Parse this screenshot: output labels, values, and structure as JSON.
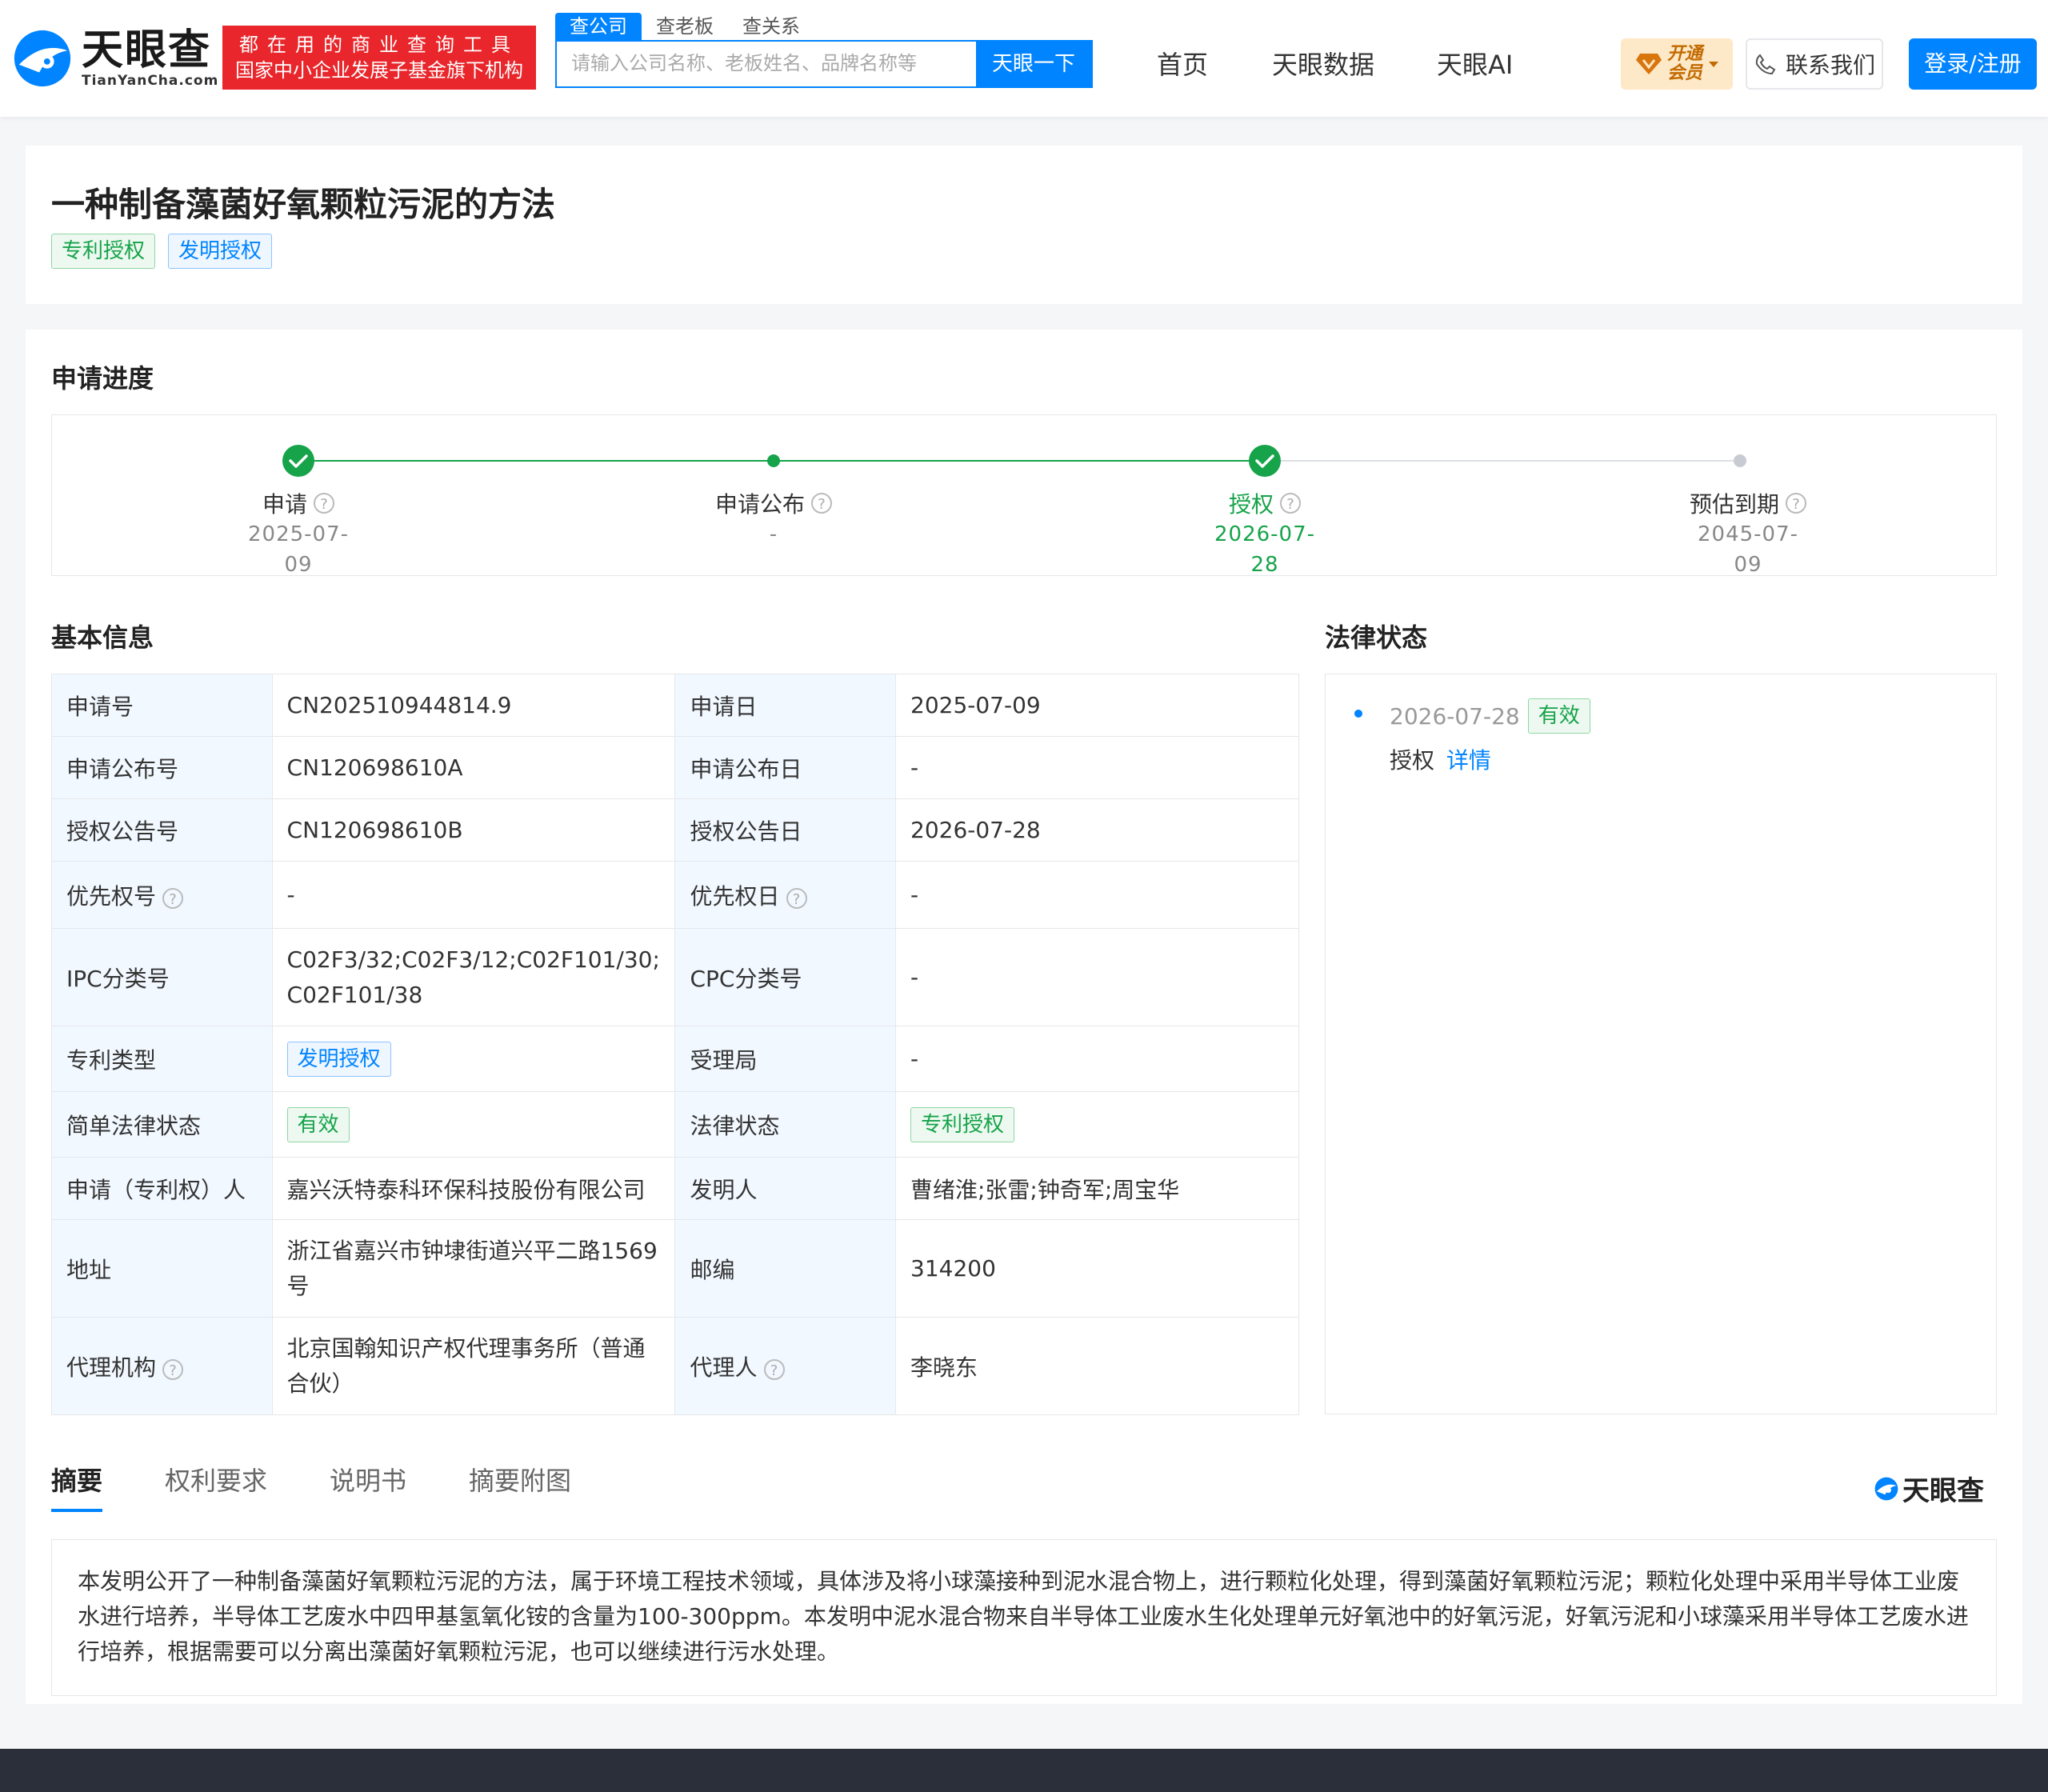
{
  "header": {
    "logo_cn": "天眼查",
    "logo_en": "TianYanCha.com",
    "slogan_line1": "都在用的商业查询工具",
    "slogan_line2": "国家中小企业发展子基金旗下机构",
    "search_tabs": [
      "查公司",
      "查老板",
      "查关系"
    ],
    "search_placeholder": "请输入公司名称、老板姓名、品牌名称等",
    "search_button": "天眼一下",
    "nav": [
      "首页",
      "天眼数据",
      "天眼AI"
    ],
    "vip_line1": "开通",
    "vip_line2": "会员",
    "contact": "联系我们",
    "login": "登录/注册"
  },
  "patent": {
    "title": "一种制备藻菌好氧颗粒污泥的方法",
    "tags": [
      "专利授权",
      "发明授权"
    ]
  },
  "progress": {
    "section_title": "申请进度",
    "steps": [
      {
        "label": "申请",
        "date_line1": "2025-07-",
        "date_line2": "09",
        "state": "done"
      },
      {
        "label": "申请公布",
        "date_line1": "-",
        "date_line2": "",
        "state": "passed"
      },
      {
        "label": "授权",
        "date_line1": "2026-07-",
        "date_line2": "28",
        "state": "current"
      },
      {
        "label": "预估到期",
        "date_line1": "2045-07-",
        "date_line2": "09",
        "state": "future"
      }
    ]
  },
  "basic_info": {
    "section_title": "基本信息",
    "rows": [
      {
        "k1": "申请号",
        "v1": "CN202510944814.9",
        "k2": "申请日",
        "v2": "2025-07-09"
      },
      {
        "k1": "申请公布号",
        "v1": "CN120698610A",
        "k2": "申请公布日",
        "v2": "-"
      },
      {
        "k1": "授权公告号",
        "v1": "CN120698610B",
        "k2": "授权公告日",
        "v2": "2026-07-28"
      },
      {
        "k1": "优先权号",
        "v1": "-",
        "k2": "优先权日",
        "v2": "-"
      },
      {
        "k1": "IPC分类号",
        "v1": "C02F3/32;C02F3/12;C02F101/30;C02F101/38",
        "k2": "CPC分类号",
        "v2": "-"
      },
      {
        "k1": "专利类型",
        "v1": "发明授权",
        "k2": "受理局",
        "v2": "-"
      },
      {
        "k1": "简单法律状态",
        "v1": "有效",
        "k2": "法律状态",
        "v2": "专利授权"
      },
      {
        "k1": "申请（专利权）人",
        "v1": "嘉兴沃特泰科环保科技股份有限公司",
        "k2": "发明人",
        "v2": "曹绪淮;张雷;钟奇军;周宝华"
      },
      {
        "k1": "地址",
        "v1": "浙江省嘉兴市钟埭街道兴平二路1569号",
        "k2": "邮编",
        "v2": "314200"
      },
      {
        "k1": "代理机构",
        "v1": "北京国翰知识产权代理事务所（普通合伙）",
        "k2": "代理人",
        "v2": "李晓东"
      }
    ]
  },
  "legal_status": {
    "section_title": "法律状态",
    "entries": [
      {
        "date": "2026-07-28",
        "badge": "有效",
        "event": "授权",
        "link": "详情"
      }
    ]
  },
  "abstract_tabs": {
    "tabs": [
      "摘要",
      "权利要求",
      "说明书",
      "摘要附图"
    ],
    "brand": "天眼查"
  },
  "abstract_text": "本发明公开了一种制备藻菌好氧颗粒污泥的方法，属于环境工程技术领域，具体涉及将小球藻接种到泥水混合物上，进行颗粒化处理，得到藻菌好氧颗粒污泥；颗粒化处理中采用半导体工业废水进行培养，半导体工艺废水中四甲基氢氧化铵的含量为100-300ppm。本发明中泥水混合物来自半导体工业废水生化处理单元好氧池中的好氧污泥，好氧污泥和小球藻采用半导体工艺废水进行培养，根据需要可以分离出藻菌好氧颗粒污泥，也可以继续进行污水处理。",
  "colors": {
    "brand_blue": "#0084ff",
    "success_green": "#16a34a",
    "slogan_red": "#e8262b",
    "key_bg": "#f2f8ff"
  }
}
